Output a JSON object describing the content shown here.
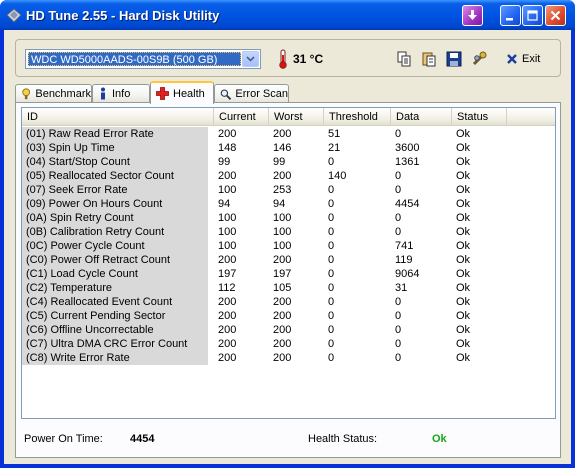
{
  "window": {
    "title": "HD Tune 2.55 - Hard Disk Utility"
  },
  "toolbar": {
    "drive": "WDC WD5000AADS-00S9B (500 GB)",
    "temperature": "31 °C",
    "exit_label": "Exit",
    "icons": [
      "copy-icon",
      "copy-text-icon",
      "save-icon",
      "options-icon",
      "exit-icon"
    ]
  },
  "tabs": [
    {
      "label": "Benchmark",
      "icon": "benchmark-icon"
    },
    {
      "label": "Info",
      "icon": "info-icon"
    },
    {
      "label": "Health",
      "icon": "health-cross-icon",
      "active": true
    },
    {
      "label": "Error Scan",
      "icon": "search-icon"
    }
  ],
  "health": {
    "columns": [
      "ID",
      "Current",
      "Worst",
      "Threshold",
      "Data",
      "Status"
    ],
    "rows": [
      [
        "(01) Raw Read Error Rate",
        "200",
        "200",
        "51",
        "0",
        "Ok"
      ],
      [
        "(03) Spin Up Time",
        "148",
        "146",
        "21",
        "3600",
        "Ok"
      ],
      [
        "(04) Start/Stop Count",
        "99",
        "99",
        "0",
        "1361",
        "Ok"
      ],
      [
        "(05) Reallocated Sector Count",
        "200",
        "200",
        "140",
        "0",
        "Ok"
      ],
      [
        "(07) Seek Error Rate",
        "100",
        "253",
        "0",
        "0",
        "Ok"
      ],
      [
        "(09) Power On Hours Count",
        "94",
        "94",
        "0",
        "4454",
        "Ok"
      ],
      [
        "(0A) Spin Retry Count",
        "100",
        "100",
        "0",
        "0",
        "Ok"
      ],
      [
        "(0B) Calibration Retry Count",
        "100",
        "100",
        "0",
        "0",
        "Ok"
      ],
      [
        "(0C) Power Cycle Count",
        "100",
        "100",
        "0",
        "741",
        "Ok"
      ],
      [
        "(C0) Power Off Retract Count",
        "200",
        "200",
        "0",
        "119",
        "Ok"
      ],
      [
        "(C1) Load Cycle Count",
        "197",
        "197",
        "0",
        "9064",
        "Ok"
      ],
      [
        "(C2) Temperature",
        "112",
        "105",
        "0",
        "31",
        "Ok"
      ],
      [
        "(C4) Reallocated Event Count",
        "200",
        "200",
        "0",
        "0",
        "Ok"
      ],
      [
        "(C5) Current Pending Sector",
        "200",
        "200",
        "0",
        "0",
        "Ok"
      ],
      [
        "(C6) Offline Uncorrectable",
        "200",
        "200",
        "0",
        "0",
        "Ok"
      ],
      [
        "(C7) Ultra DMA CRC Error Count",
        "200",
        "200",
        "0",
        "0",
        "Ok"
      ],
      [
        "(C8) Write Error Rate",
        "200",
        "200",
        "0",
        "0",
        "Ok"
      ]
    ]
  },
  "footer": {
    "power_on_label": "Power On Time:",
    "power_on_value": "4454",
    "health_status_label": "Health Status:",
    "health_status_value": "Ok"
  },
  "colors": {
    "titlebar": "#0054e3",
    "selection": "#316ac5",
    "health_ok": "#14a814",
    "id_column": "#d9d9d9"
  }
}
